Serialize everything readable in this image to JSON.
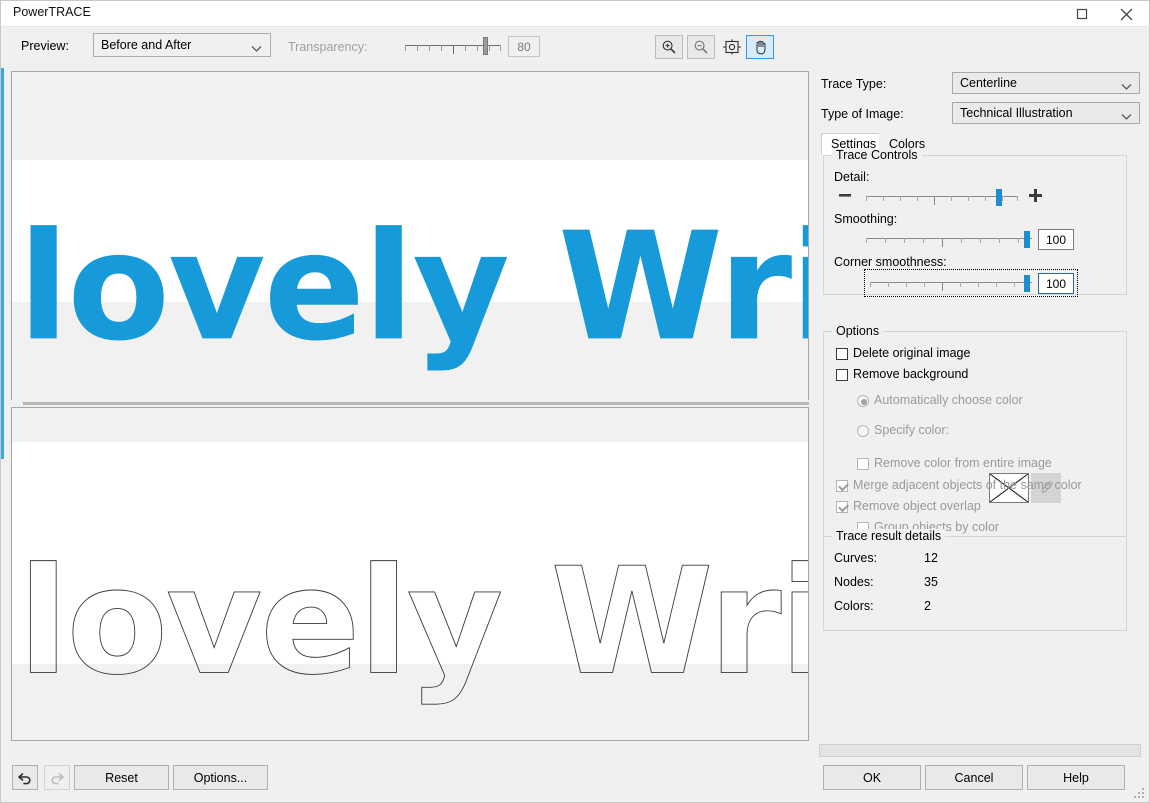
{
  "window": {
    "title": "PowerTRACE",
    "maximize_icon": "maximize-icon",
    "close_icon": "close-icon"
  },
  "toolbar": {
    "preview_label": "Preview:",
    "preview_value": "Before and After",
    "preview_options": [
      "Before and After"
    ],
    "transparency_label": "Transparency:",
    "transparency_value": "80",
    "zoom_in_icon": "zoom-in-icon",
    "zoom_out_icon": "zoom-out-icon",
    "fit_icon": "fit-to-window-icon",
    "pan_icon": "pan-hand-icon"
  },
  "preview": {
    "before_text": "lovely Writer",
    "after_text": "lovely Writer",
    "artwork_color": "#179ad9"
  },
  "right": {
    "trace_type_label": "Trace Type:",
    "trace_type_value": "Centerline",
    "type_of_image_label": "Type of Image:",
    "type_of_image_value": "Technical Illustration",
    "tabs": [
      {
        "label": "Settings",
        "active": true
      },
      {
        "label": "Colors",
        "active": false
      }
    ],
    "trace_controls": {
      "legend": "Trace Controls",
      "detail_label": "Detail:",
      "detail_percent": 88,
      "minus_icon": "minus-icon",
      "plus_icon": "plus-icon",
      "smoothing_label": "Smoothing:",
      "smoothing_value": "100",
      "smoothing_percent": 93,
      "corner_label": "Corner smoothness:",
      "corner_value": "100",
      "corner_percent": 93
    },
    "options": {
      "legend": "Options",
      "delete_original": {
        "label": "Delete original image",
        "checked": false,
        "enabled": true
      },
      "remove_background": {
        "label": "Remove background",
        "checked": false,
        "enabled": true
      },
      "auto_color": {
        "label": "Automatically choose color",
        "selected": true,
        "enabled": false
      },
      "specify_color": {
        "label": "Specify color:",
        "selected": false,
        "enabled": false
      },
      "eyedropper_icon": "eyedropper-icon",
      "remove_color_entire": {
        "label": "Remove color from entire image",
        "checked": false,
        "enabled": false
      },
      "merge_adjacent": {
        "label": "Merge adjacent objects of the same color",
        "checked": true,
        "enabled": false
      },
      "remove_overlap": {
        "label": "Remove object overlap",
        "checked": true,
        "enabled": false
      },
      "group_by_color": {
        "label": "Group objects by color",
        "checked": false,
        "enabled": false
      }
    },
    "results": {
      "legend": "Trace result details",
      "curves_label": "Curves:",
      "curves_value": "12",
      "nodes_label": "Nodes:",
      "nodes_value": "35",
      "colors_label": "Colors:",
      "colors_value": "2"
    }
  },
  "footer": {
    "undo_icon": "undo-arrow-icon",
    "redo_icon": "redo-arrow-icon",
    "reset_label": "Reset",
    "options_label": "Options...",
    "ok_label": "OK",
    "cancel_label": "Cancel",
    "help_label": "Help",
    "progress_percent": 0
  },
  "accent_color": "#3aa9d6"
}
